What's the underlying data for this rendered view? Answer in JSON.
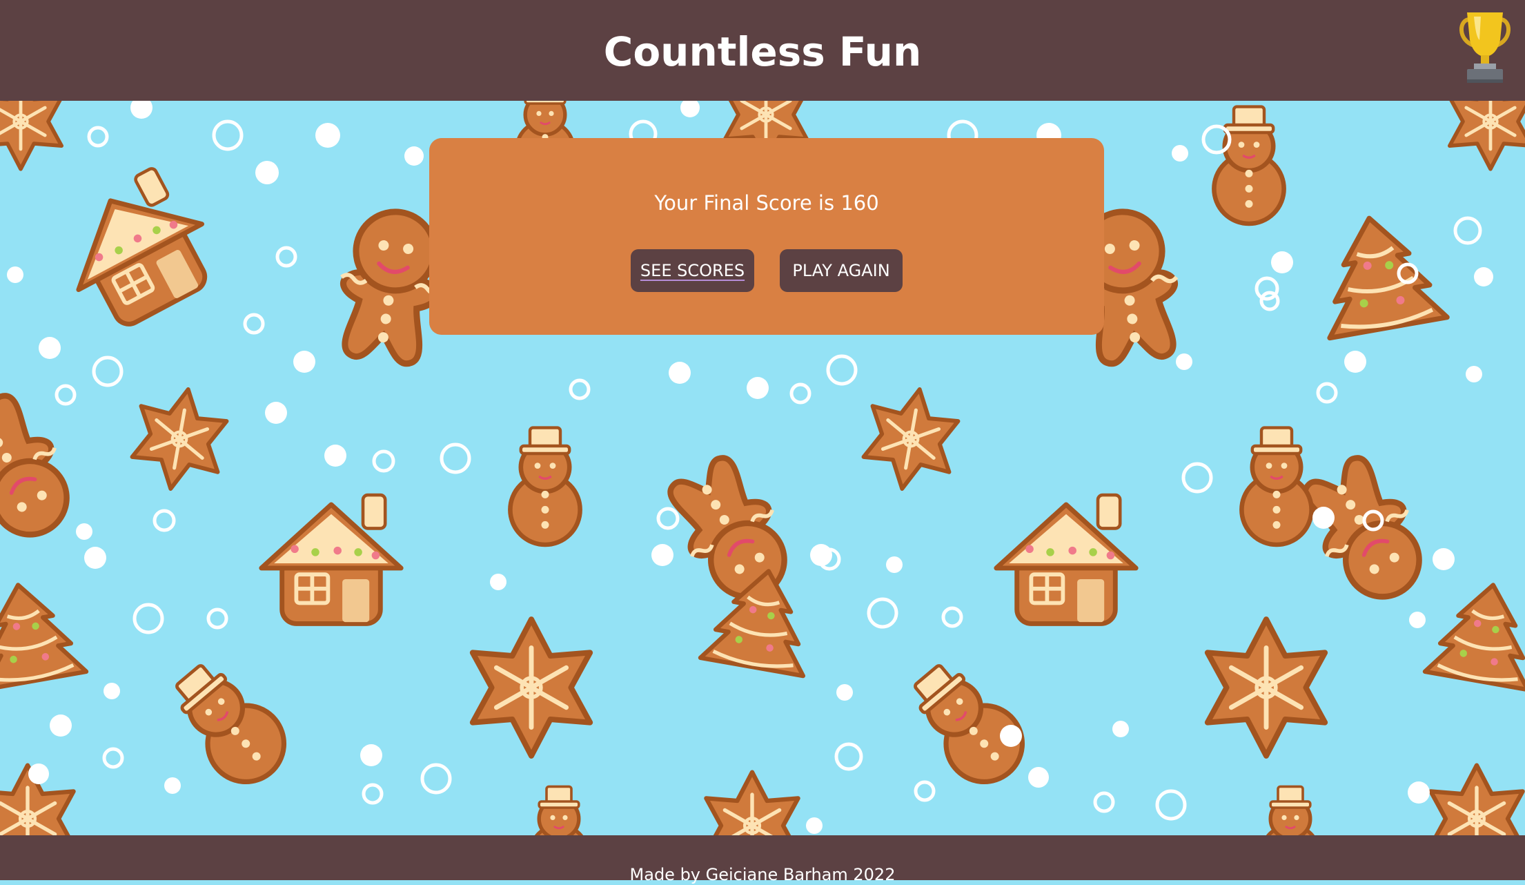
{
  "header": {
    "title": "Countless Fun",
    "trophy_icon": "trophy-icon"
  },
  "modal": {
    "score_text": "Your Final Score is 160",
    "see_scores_label": "SEE SCORES",
    "play_again_label": "PLAY AGAIN"
  },
  "footer": {
    "credit": "Made by Geiciane Barham 2022"
  },
  "colors": {
    "header_bg": "#5c4143",
    "sky_bg": "#94e2f5",
    "modal_bg": "#d98043",
    "button_bg": "#5c4143",
    "cookie": "#d07a3c",
    "icing": "#fde3b4"
  }
}
